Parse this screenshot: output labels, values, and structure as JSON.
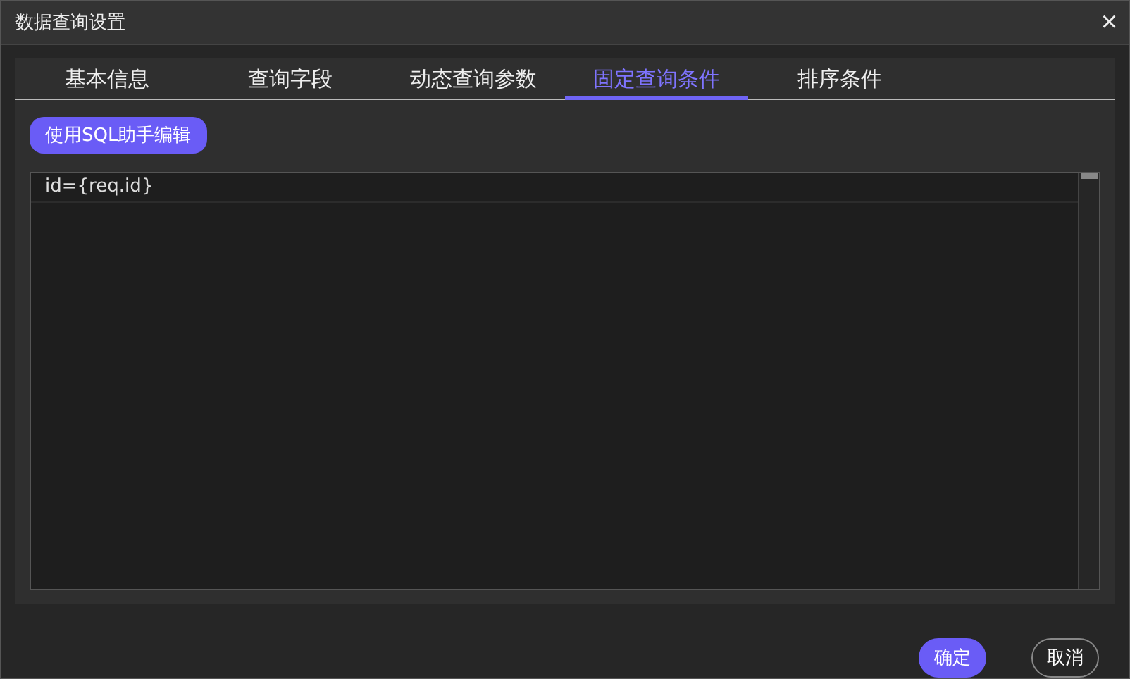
{
  "window": {
    "title": "数据查询设置",
    "close": "×"
  },
  "tabs": [
    {
      "label": "基本信息",
      "selected": false
    },
    {
      "label": "查询字段",
      "selected": false
    },
    {
      "label": "动态查询参数",
      "selected": false
    },
    {
      "label": "固定查询条件",
      "selected": true
    },
    {
      "label": "排序条件",
      "selected": false
    }
  ],
  "sql_button": "使用SQL助手编辑",
  "editor": {
    "lines": [
      "id={req.id}"
    ]
  },
  "buttons": [
    {
      "label": "确定",
      "kind": "primary"
    },
    {
      "label": "取消",
      "kind": "secondary"
    }
  ]
}
